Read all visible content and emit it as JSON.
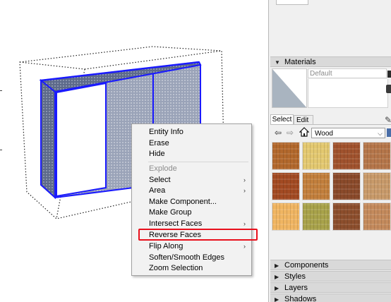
{
  "context_menu": {
    "items": [
      {
        "label": "Entity Info",
        "enabled": true,
        "submenu": false
      },
      {
        "label": "Erase",
        "enabled": true,
        "submenu": false
      },
      {
        "label": "Hide",
        "enabled": true,
        "submenu": false
      },
      {
        "label": "Explode",
        "enabled": false,
        "submenu": false
      },
      {
        "label": "Select",
        "enabled": true,
        "submenu": true
      },
      {
        "label": "Area",
        "enabled": true,
        "submenu": true
      },
      {
        "label": "Make Component...",
        "enabled": true,
        "submenu": false
      },
      {
        "label": "Make Group",
        "enabled": true,
        "submenu": false
      },
      {
        "label": "Intersect Faces",
        "enabled": true,
        "submenu": true
      },
      {
        "label": "Reverse Faces",
        "enabled": true,
        "submenu": false,
        "highlighted": true
      },
      {
        "label": "Flip Along",
        "enabled": true,
        "submenu": true
      },
      {
        "label": "Soften/Smooth Edges",
        "enabled": true,
        "submenu": false
      },
      {
        "label": "Zoom Selection",
        "enabled": true,
        "submenu": false
      }
    ],
    "submenu_glyph": "›",
    "highlight_color": "#e8101c"
  },
  "materials_panel": {
    "title": "Materials",
    "current_material": "Default",
    "tabs": [
      {
        "label": "Select",
        "active": true
      },
      {
        "label": "Edit",
        "active": false
      }
    ],
    "library": "Wood",
    "swatches": [
      "#b2682c",
      "#e3c870",
      "#a0522d",
      "#b5764a",
      "#a24a22",
      "#c27f3c",
      "#8a4a2a",
      "#c89a6a",
      "#f0b562",
      "#a8a24a",
      "#8c4e2c",
      "#c48a5c"
    ]
  },
  "collapsed_panels": [
    {
      "label": "Components"
    },
    {
      "label": "Styles"
    },
    {
      "label": "Layers"
    },
    {
      "label": "Shadows"
    }
  ],
  "icons": [
    "back-arrow-icon",
    "forward-arrow-icon",
    "home-icon",
    "chevron-down-icon",
    "pencil-icon",
    "expand-triangle-icon",
    "collapse-triangle-icon"
  ],
  "colors": {
    "selection_blue": "#1a1aff",
    "panel_bg": "#f0f0f0",
    "header_bg": "#d9d9d9"
  }
}
